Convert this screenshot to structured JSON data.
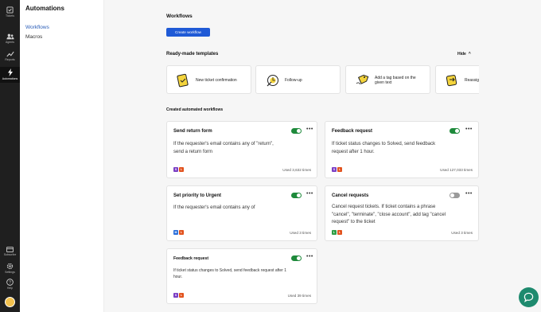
{
  "rail": {
    "items": [
      {
        "label": "Tickets",
        "icon": "tickets-icon"
      },
      {
        "label": "Agents",
        "icon": "agents-icon"
      },
      {
        "label": "Reports",
        "icon": "reports-icon"
      },
      {
        "label": "Automations",
        "icon": "automations-icon"
      },
      {
        "label": "Subscribe",
        "icon": "subscribe-icon"
      },
      {
        "label": "Settings",
        "icon": "settings-icon"
      },
      {
        "label": "Help",
        "icon": "help-icon"
      }
    ]
  },
  "sidebar": {
    "title": "Automations",
    "items": [
      {
        "label": "Workflows",
        "active": true
      },
      {
        "label": "Macros",
        "active": false
      }
    ]
  },
  "main": {
    "workflows_heading": "Workflows",
    "create_button": "Create workflow",
    "templates_heading": "Ready-made templates",
    "hide_label": "Hide",
    "templates": [
      {
        "label": "New ticket confirmation",
        "icon": "ticket-icon"
      },
      {
        "label": "Follow-up",
        "icon": "follow-up-icon"
      },
      {
        "label": "Add a tag based on the given text",
        "icon": "tag-icon"
      },
      {
        "label": "Reassign",
        "icon": "reassign-icon"
      }
    ],
    "created_heading": "Created automated workflows",
    "workflows": [
      {
        "title": "Send return form",
        "description": "If the requester's email contains any of \"return\", send a return form",
        "enabled": true,
        "badges": [
          "S",
          "L"
        ],
        "used": "Used 3,632 times"
      },
      {
        "title": "Feedback request",
        "description": "If ticket status changes to Solved, send feedback request after 1 hour.",
        "enabled": true,
        "badges": [
          "S",
          "L"
        ],
        "used": "Used 127,033 times"
      },
      {
        "title": "Set priority to Urgent",
        "description": "If the requester's email contains any of",
        "enabled": true,
        "badges": [
          "M",
          "L"
        ],
        "used": "Used 3 times"
      },
      {
        "title": "Cancel requests",
        "description": "Cancel request tickets. If ticket contains a phrase \"cancel\", \"terminate\", \"close account\", add tag \"cancel request\" to the ticket",
        "enabled": false,
        "badges": [
          "L",
          "L"
        ],
        "used": "Used 3 times"
      },
      {
        "title": "Feedback request",
        "description": "If ticket status changes to Solved, send feedback request after 1 hour.",
        "enabled": true,
        "badges": [
          "S",
          "L"
        ],
        "used": "Used 39 times"
      }
    ]
  },
  "colors": {
    "accent": "#1f5ad6",
    "toggle_on": "#1e8a3b",
    "badge_S": "#7b3fc4",
    "badge_L": "#e2531e",
    "badge_M": "#2a6fdb",
    "badge_L_green": "#2e9e45",
    "chat": "#1e8a6e"
  }
}
